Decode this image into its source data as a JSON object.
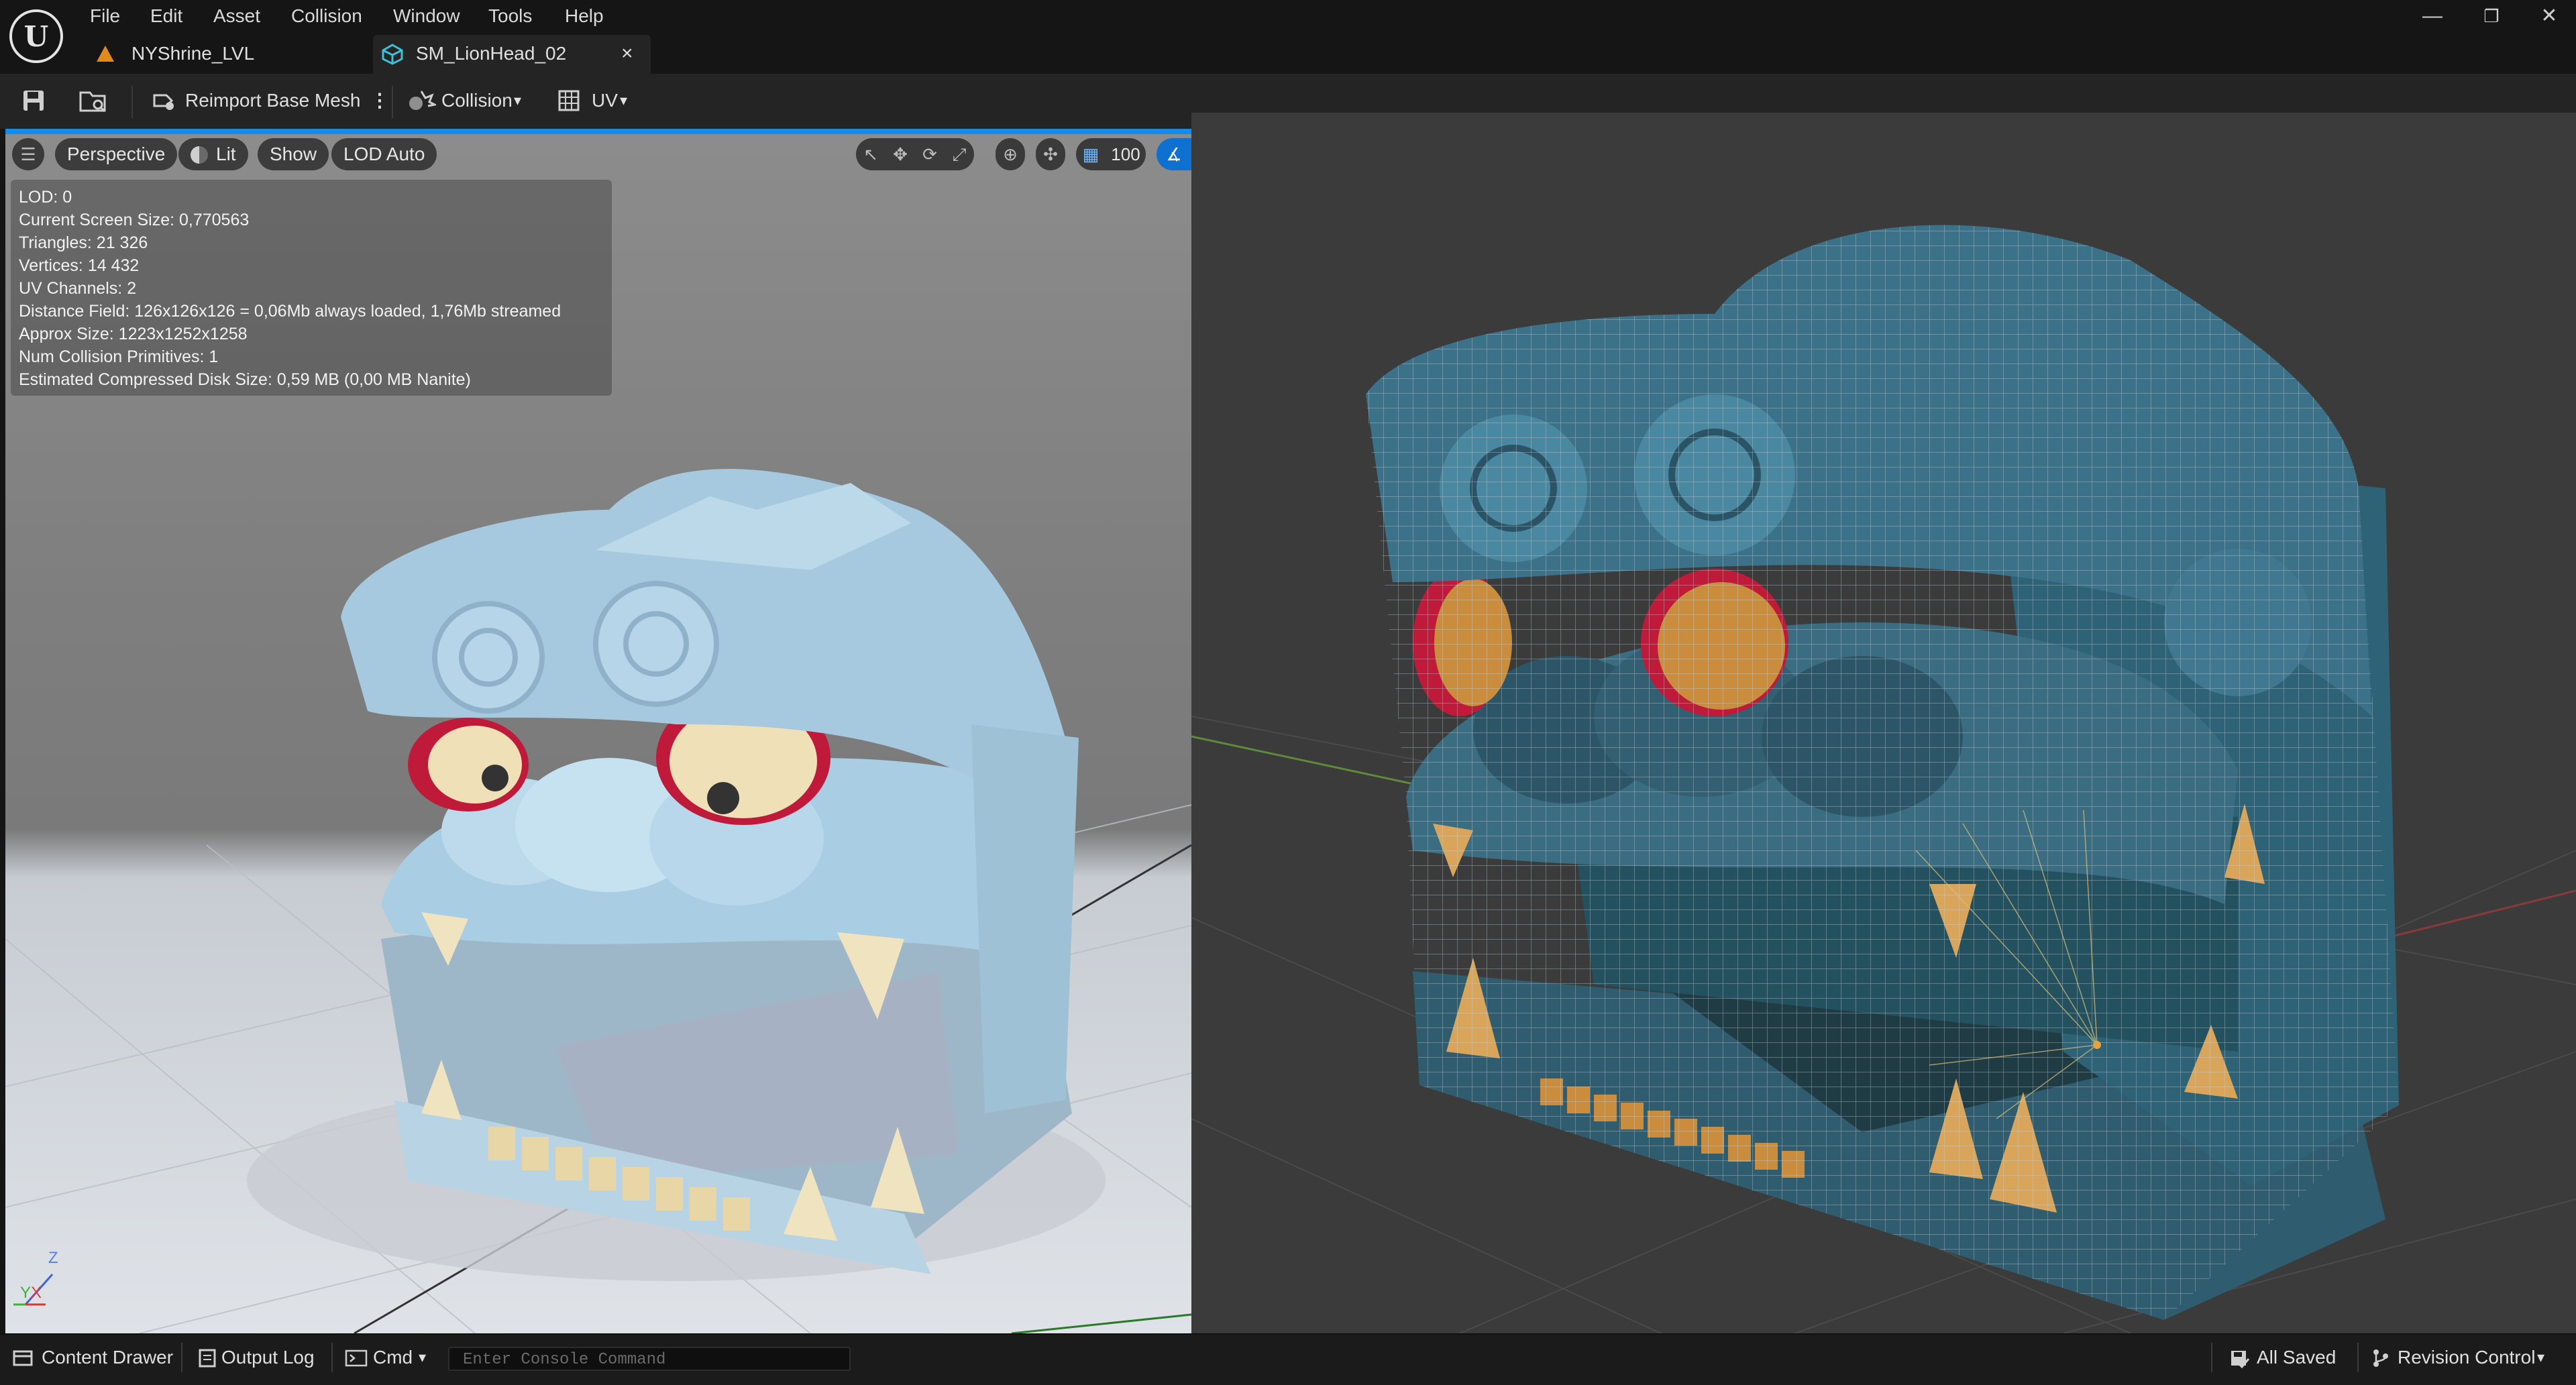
{
  "menu": [
    "File",
    "Edit",
    "Asset",
    "Collision",
    "Window",
    "Tools",
    "Help"
  ],
  "tabs": [
    {
      "label": "NYShrine_LVL",
      "icon": "level-icon"
    },
    {
      "label": "SM_LionHead_02",
      "icon": "static-mesh-icon",
      "close": "×"
    }
  ],
  "window_controls": {
    "minimize": "—",
    "restore": "❐",
    "close": "✕"
  },
  "toolbar": {
    "reimport_label": "Reimport Base Mesh",
    "collision_label": "Collision",
    "uv_label": "UV"
  },
  "viewport": {
    "perspective": "Perspective",
    "lit": "Lit",
    "show": "Show",
    "lod": "LOD Auto",
    "grid_value": "100",
    "axis_z": "Z",
    "axis_y": "Y",
    "axis_x": "X"
  },
  "stats": [
    "LOD:  0",
    "Current Screen Size:  0,770563",
    "Triangles:  21 326",
    "Vertices:  14 432",
    "UV Channels:  2",
    "Distance Field:  126x126x126 = 0,06Mb always loaded, 1,76Mb streamed",
    "Approx Size: 1223x1252x1258",
    "Num Collision Primitives:  1",
    "Estimated Compressed Disk Size: 0,59 MB (0,00 MB Nanite)"
  ],
  "statusbar": {
    "content_drawer": "Content Drawer",
    "output_log": "Output Log",
    "cmd": "Cmd",
    "console_placeholder": "Enter Console Command",
    "all_saved": "All Saved",
    "revision_control": "Revision Control"
  },
  "colors": {
    "accent": "#0e8cf0",
    "menu_bg": "#151515",
    "toolbar_bg": "#242424"
  }
}
